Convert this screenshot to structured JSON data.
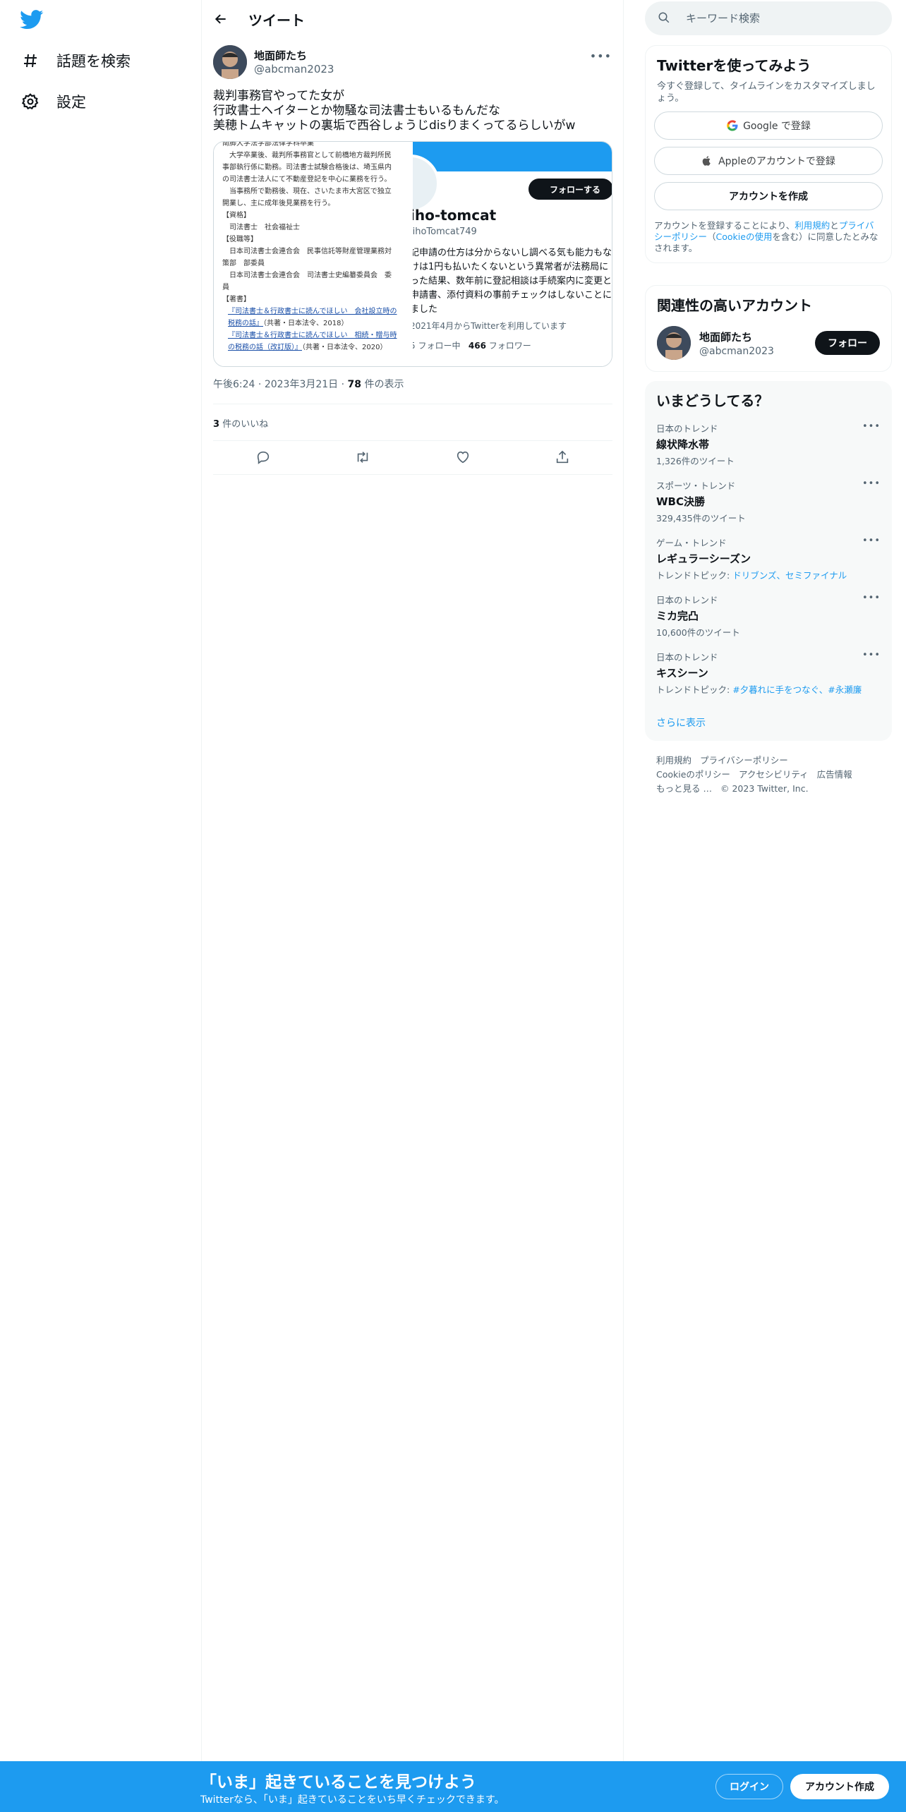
{
  "nav": {
    "items": [
      {
        "label": "話題を検索",
        "icon": "hashtag-icon"
      },
      {
        "label": "設定",
        "icon": "gear-icon"
      }
    ]
  },
  "header": {
    "title": "ツイート"
  },
  "tweet": {
    "author_name": "地面師たち",
    "author_handle": "@abcman2023",
    "text": "裁判事務官やってた女が\n行政書士ヘイターとか物騒な司法書士もいるもんだな\n美穂トムキャットの裏垢で西谷しょうじdisりまくってるらしいがw",
    "time": "午後6:24",
    "date": "2023年3月21日",
    "views_count": "78",
    "views_label": "件の表示",
    "likes_count": "3",
    "likes_label": "件のいいね",
    "media_left": {
      "lines": [
        "南脚大学法学部法律学科卒業",
        "　大学卒業後、裁判所事務官として前橋地方裁判所民",
        "事部執行係に勤務。司法書士試験合格後は、埼玉県内",
        "の司法書士法人にて不動産登記を中心に業務を行う。",
        "　当事務所で勤務後、現在、さいたま市大宮区で独立",
        "開業し、主に成年後見業務を行う。",
        "【資格】",
        "　司法書士　社会福祉士",
        "【役職等】",
        "　日本司法書士会連合会　民事信託等財産管理業務対",
        "策部　部委員",
        "　日本司法書士会連合会　司法書士史編纂委員会　委",
        "員",
        "【著書】"
      ],
      "book1_link": "『司法書士＆行政書士に読んでほしい　会社設立時の税務の話』",
      "book1_note": "（共著・日本法令、2018）",
      "book2_link": "『司法書士＆行政書士に読んでほしい　相続・贈与時の税務の話（改訂版）』",
      "book2_note": "（共著・日本法令、2020）"
    },
    "media_right": {
      "follow_label": "フォローする",
      "name": "iho-tomcat",
      "handle": "lihoTomcat749",
      "bio": "記申請の仕方は分からないし調べる気も能力もな\nけは1円も払いたくないという異常者が法務局に\nった結果、数年前に登記相談は手続案内に変更と\n申請書、添付資料の事前チェックはしないことに\nました",
      "joined": "2021年4月からTwitterを利用しています",
      "following_prefix": "5 フォロー中",
      "followers_count": "466",
      "followers_label": "フォロワー"
    }
  },
  "search": {
    "placeholder": "キーワード検索"
  },
  "signup": {
    "title": "Twitterを使ってみよう",
    "subtitle": "今すぐ登録して、タイムラインをカスタマイズしましょう。",
    "google_label": "Google で登録",
    "apple_label": "Appleのアカウントで登録",
    "create_label": "アカウントを作成",
    "legal_prefix": "アカウントを登録することにより、",
    "terms_link": "利用規約",
    "and": "と",
    "privacy_link": "プライバシーポリシー",
    "cookie_open": "（",
    "cookie_link": "Cookieの使用",
    "legal_suffix": "を含む）に同意したとみなされます。"
  },
  "related": {
    "title": "関連性の高いアカウント",
    "name": "地面師たち",
    "handle": "@abcman2023",
    "follow_label": "フォロー"
  },
  "trends": {
    "title": "いまどうしてる？",
    "items": [
      {
        "category": "日本のトレンド",
        "name": "線状降水帯",
        "count": "1,326件のツイート"
      },
      {
        "category": "スポーツ・トレンド",
        "name": "WBC決勝",
        "count": "329,435件のツイート"
      },
      {
        "category": "ゲーム・トレンド",
        "name": "レギュラーシーズン",
        "topic_prefix": "トレンドトピック: ",
        "topics": "ドリブンズ、セミファイナル"
      },
      {
        "category": "日本のトレンド",
        "name": "ミカ完凸",
        "count": "10,600件のツイート"
      },
      {
        "category": "日本のトレンド",
        "name": "キスシーン",
        "topic_prefix": "トレンドトピック: ",
        "topics": "#夕暮れに手をつなぐ、#永瀬廉"
      }
    ],
    "show_more": "さらに表示"
  },
  "footer": {
    "links": [
      "利用規約",
      "プライバシーポリシー",
      "Cookieのポリシー",
      "アクセシビリティ",
      "広告情報",
      "もっと見る …"
    ],
    "copyright": "© 2023 Twitter, Inc."
  },
  "bottom_bar": {
    "title": "「いま」起きていることを見つけよう",
    "subtitle": "Twitterなら、「いま」起きていることをいち早くチェックできます。",
    "login_label": "ログイン",
    "signup_label": "アカウント作成"
  },
  "colors": {
    "accent": "#1d9bf0",
    "text": "#0f1419",
    "muted": "#536471"
  }
}
